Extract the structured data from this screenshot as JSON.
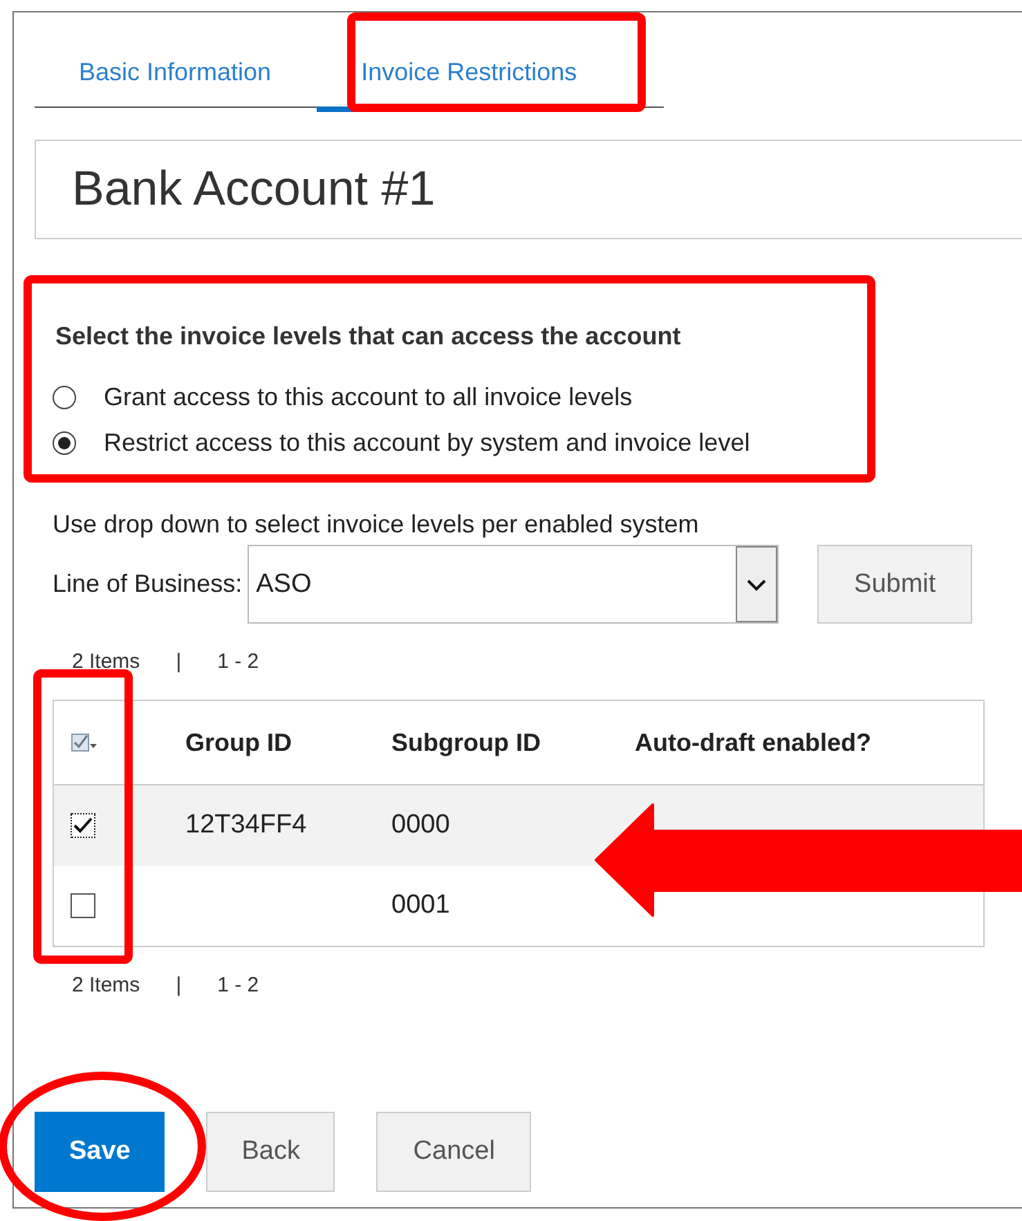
{
  "tabs": [
    {
      "label": "Basic Information",
      "selected": false
    },
    {
      "label": "Invoice Restrictions",
      "selected": true
    }
  ],
  "account_title": "Bank Account #1",
  "access": {
    "heading": "Select the invoice levels that can access the account",
    "options": [
      {
        "label": "Grant access to this account to all invoice levels",
        "selected": false
      },
      {
        "label": "Restrict access to this account by system and invoice level",
        "selected": true
      }
    ]
  },
  "instructions": "Use drop down to select invoice levels per enabled system",
  "line_of_business": {
    "label": "Line of Business:",
    "value": "ASO"
  },
  "submit_button": "Submit",
  "pager_top": {
    "count": "2 Items",
    "separator": "|",
    "range": "1 - 2"
  },
  "table": {
    "columns": [
      "Group ID",
      "Subgroup ID",
      "Auto-draft enabled?"
    ],
    "rows": [
      {
        "checked": true,
        "cells": [
          "12T34FF4",
          "0000",
          ""
        ]
      },
      {
        "checked": false,
        "cells": [
          "",
          "0001",
          ""
        ]
      }
    ]
  },
  "pager_bottom": {
    "count": "2 Items",
    "separator": "|",
    "range": "1 - 2"
  },
  "buttons": [
    {
      "label": "Save",
      "kind": "primary"
    },
    {
      "label": "Back",
      "kind": "secondary"
    },
    {
      "label": "Cancel",
      "kind": "secondary"
    }
  ]
}
